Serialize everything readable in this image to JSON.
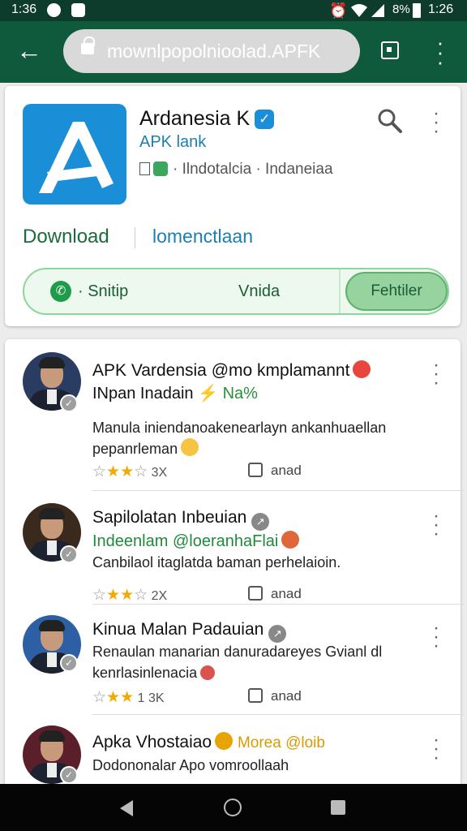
{
  "status": {
    "left_time": "1:36",
    "battery_pct": "8%",
    "right_time": "1:26"
  },
  "browser": {
    "url": "mownlpopolnioolad.APFK"
  },
  "app": {
    "title": "Ardanesia",
    "title_suffix": "K",
    "subtitle": "APK lank",
    "meta": "· Ilndotalcia · Indaneiaa",
    "download_label": "Download",
    "secondary_label": "lomenctlaan",
    "share_label": "· Snitip",
    "middle_label": "Vnida",
    "follow_label": "Fehtiler",
    "accent": "#1a6b3a",
    "link_color": "#1c7fb0"
  },
  "reviews": [
    {
      "name": "APK Vardensia @mo kmplamannt",
      "sub": "INpan Inadain",
      "sub_extra": "Na%",
      "body": "Manula iniendanoakenearlayn ankanhuaellan pepanrleman",
      "stars": "3X",
      "action": "anad"
    },
    {
      "name": "Sapilolatan Inbeuian",
      "sub": "Indeenlam @loeranhaFlai",
      "body": "Canbilaol itaglatda baman perhelaioin.",
      "stars": "2X",
      "action": "anad"
    },
    {
      "name": "Kinua Malan Padauian",
      "sub": "",
      "body": "Renaulan manarian danuradareyes Gvianl dl kenrlasinlenacia",
      "stars": "1 3K",
      "action": "anad"
    },
    {
      "name": "Apka Vhostaiao",
      "sub": "Morea @loib",
      "body": "Dodononalar Apo vomroollaah",
      "stars": "",
      "action": ""
    }
  ]
}
